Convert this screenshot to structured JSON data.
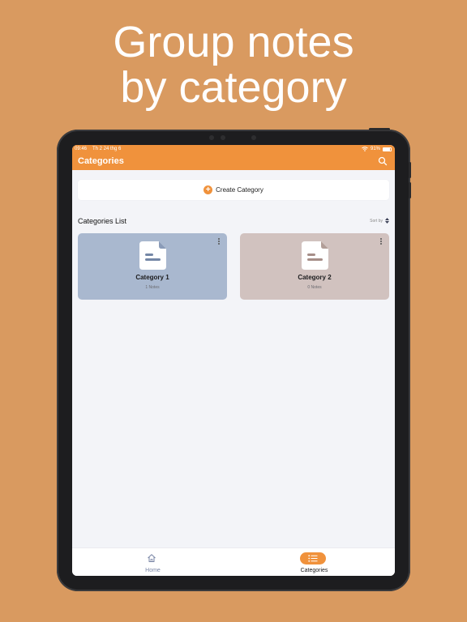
{
  "headline": {
    "line1": "Group notes",
    "line2": "by category"
  },
  "status_bar": {
    "time": "09:46",
    "date": "Th 2 24 thg 6",
    "battery": "91%"
  },
  "nav": {
    "title": "Categories"
  },
  "create_button": {
    "label": "Create Category"
  },
  "list": {
    "title": "Categories List",
    "sort_label": "Sort by"
  },
  "categories": [
    {
      "name": "Category 1",
      "count": "1 Notes",
      "color": "#A9B8CF"
    },
    {
      "name": "Category 2",
      "count": "0 Notes",
      "color": "#D1C2BF"
    }
  ],
  "tabbar": {
    "home": "Home",
    "categories": "Categories"
  },
  "colors": {
    "accent": "#F0923C",
    "background": "#D99A60"
  }
}
